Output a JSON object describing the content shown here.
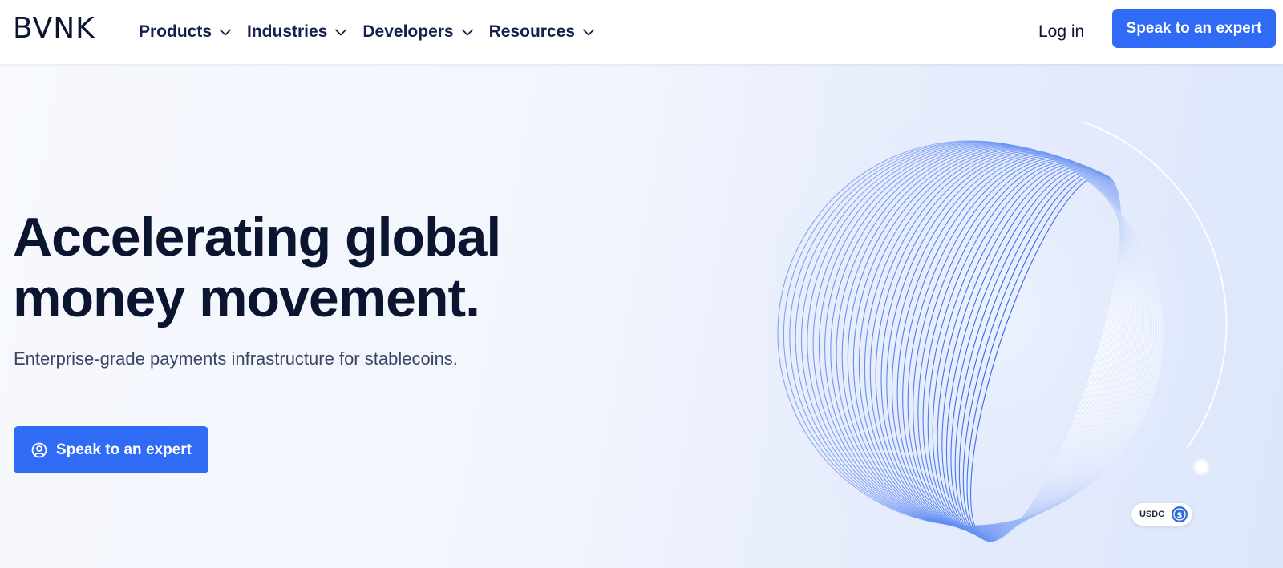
{
  "header": {
    "logo": "BVNK",
    "nav": [
      {
        "label": "Products"
      },
      {
        "label": "Industries"
      },
      {
        "label": "Developers"
      },
      {
        "label": "Resources"
      }
    ],
    "login_label": "Log in",
    "cta_label": "Speak to an expert"
  },
  "hero": {
    "title_line1": "Accelerating global",
    "title_line2": "money movement.",
    "subtitle": "Enterprise-grade payments infrastructure for stablecoins.",
    "cta_label": "Speak to an expert",
    "cta_icon": "user-circle-icon"
  },
  "visual": {
    "badge_label": "USDC",
    "badge_icon": "usdc-coin-icon"
  },
  "colors": {
    "accent": "#2f6bf4",
    "text": "#0b1530"
  }
}
